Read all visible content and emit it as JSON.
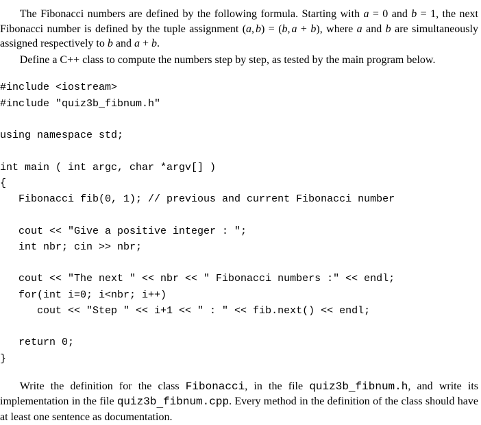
{
  "para1_pre": "The Fibonacci numbers are defined by the following formula. Starting with ",
  "eqn_a": "a",
  "eqn_eq0": " = 0 and ",
  "eqn_b": "b",
  "eqn_eq1": " = 1, the next Fibonacci number is defined by the tuple assignment (",
  "eqn_a2": "a",
  "eqn_comma": ",",
  "eqn_b2": "b",
  "eqn_paren_eq": ") = (",
  "eqn_b3": "b",
  "eqn_comma2": ",",
  "eqn_a3": "a",
  "eqn_plus": " + ",
  "eqn_b4": "b",
  "eqn_close": "), where ",
  "eqn_a4": "a",
  "eqn_and": " and ",
  "eqn_b5": "b",
  "eqn_tail": " are simultaneously assigned respectively to ",
  "eqn_b6": "b",
  "eqn_and2": " and ",
  "eqn_a5": "a",
  "eqn_plus2": " + ",
  "eqn_b7": "b",
  "eqn_period": ".",
  "para2": "Define a C++ class to compute the numbers step by step, as tested by the main program below.",
  "code": "#include <iostream>\n#include \"quiz3b_fibnum.h\"\n\nusing namespace std;\n\nint main ( int argc, char *argv[] )\n{\n   Fibonacci fib(0, 1); // previous and current Fibonacci number\n\n   cout << \"Give a positive integer : \";\n   int nbr; cin >> nbr;\n\n   cout << \"The next \" << nbr << \" Fibonacci numbers :\" << endl;\n   for(int i=0; i<nbr; i++)\n      cout << \"Step \" << i+1 << \" : \" << fib.next() << endl;\n\n   return 0;\n}",
  "para3_a": "Write the definition for the class ",
  "tt1": "Fibonacci",
  "para3_b": ", in the file ",
  "tt2": "quiz3b",
  "tt2u": "_",
  "tt2b": "fibnum.h",
  "para3_c": ", and write its implementation in the file ",
  "tt3": "quiz3b",
  "tt3u": "_",
  "tt3b": "fibnum.cpp",
  "para3_d": ". Every method in the definition of the class should have at least one sentence as documentation."
}
